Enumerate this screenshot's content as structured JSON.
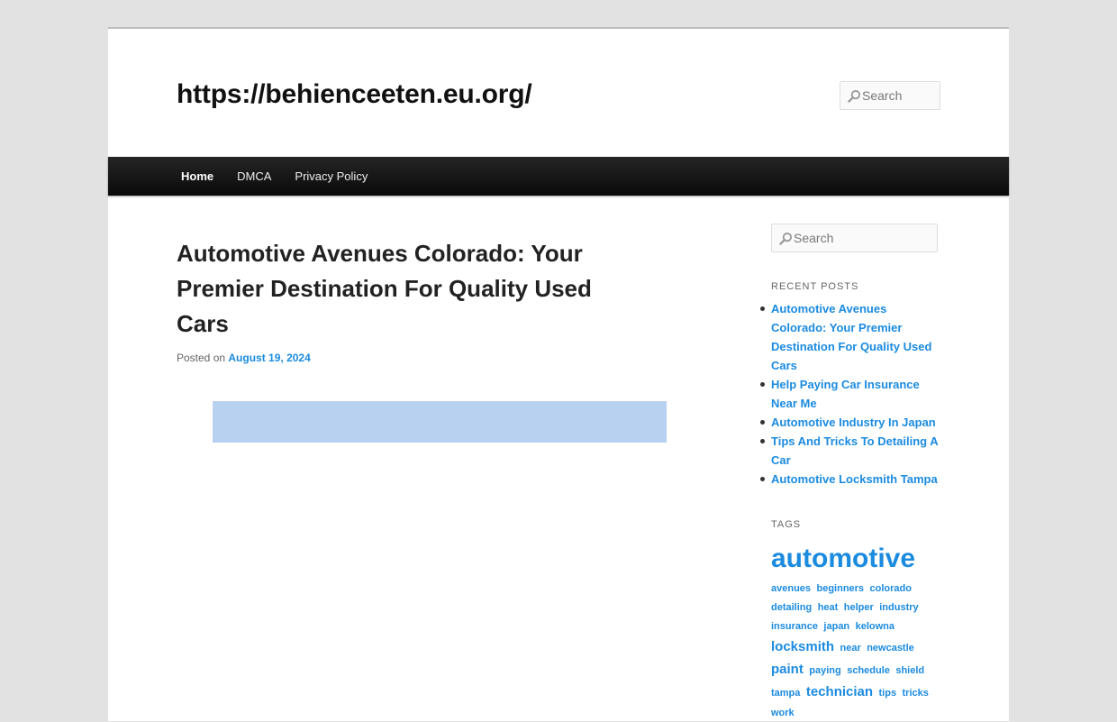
{
  "site": {
    "title": "https://behienceeten.eu.org/"
  },
  "header_search": {
    "placeholder": "Search"
  },
  "nav": {
    "items": [
      {
        "label": "Home",
        "active": true
      },
      {
        "label": "DMCA",
        "active": false
      },
      {
        "label": "Privacy Policy",
        "active": false
      }
    ]
  },
  "post": {
    "title": "Automotive Avenues Colorado: Your Premier Destination For Quality Used Cars",
    "posted_on_label": "Posted on",
    "date": "August 19, 2024"
  },
  "sidebar": {
    "search_placeholder": "Search",
    "recent_posts_title": "Recent Posts",
    "recent_posts": [
      "Automotive Avenues Colorado: Your Premier Destination For Quality Used Cars",
      "Help Paying Car Insurance Near Me",
      "Automotive Industry In Japan",
      "Tips And Tricks To Detailing A Car",
      "Automotive Locksmith Tampa"
    ],
    "tags_title": "Tags",
    "tags": [
      {
        "label": "automotive",
        "size": "xl"
      },
      {
        "label": "avenues",
        "size": "sm"
      },
      {
        "label": "beginners",
        "size": "sm"
      },
      {
        "label": "colorado",
        "size": "sm"
      },
      {
        "label": "detailing",
        "size": "sm"
      },
      {
        "label": "heat",
        "size": "sm"
      },
      {
        "label": "helper",
        "size": "sm"
      },
      {
        "label": "industry",
        "size": "sm"
      },
      {
        "label": "insurance",
        "size": "sm"
      },
      {
        "label": "japan",
        "size": "sm"
      },
      {
        "label": "kelowna",
        "size": "sm"
      },
      {
        "label": "locksmith",
        "size": "md"
      },
      {
        "label": "near",
        "size": "sm"
      },
      {
        "label": "newcastle",
        "size": "sm"
      },
      {
        "label": "paint",
        "size": "md"
      },
      {
        "label": "paying",
        "size": "sm"
      },
      {
        "label": "schedule",
        "size": "sm"
      },
      {
        "label": "shield",
        "size": "sm"
      },
      {
        "label": "tampa",
        "size": "sm"
      },
      {
        "label": "technician",
        "size": "md"
      },
      {
        "label": "tips",
        "size": "sm"
      },
      {
        "label": "tricks",
        "size": "sm"
      },
      {
        "label": "work",
        "size": "sm"
      }
    ]
  },
  "colors": {
    "link": "#1b8be0",
    "nav_bg": "#151515",
    "ad_block": "#b9d1f1"
  }
}
